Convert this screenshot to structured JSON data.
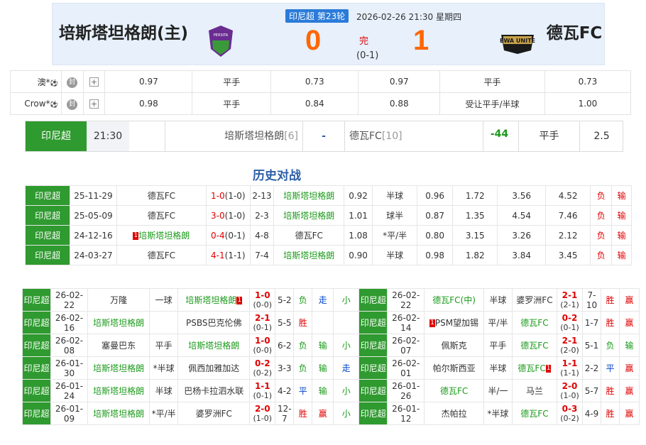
{
  "match": {
    "league_round": "印尼超 第23轮",
    "datetime": "2026-02-26 21:30 星期四",
    "home": "培斯塔坦格朗(主)",
    "away": "德瓦FC",
    "home_score": "0",
    "away_score": "1",
    "status": "完",
    "halftime": "(0-1)",
    "home_logo_text": "PERSITA",
    "away_logo_text": "DEWA UNITED"
  },
  "odds": [
    {
      "company": "澳*",
      "icon": "封",
      "v1": "0.97",
      "h1": "平手",
      "v2": "0.73",
      "v3": "0.97",
      "h2": "平手",
      "v4": "0.73"
    },
    {
      "company": "Crow*",
      "icon": "封",
      "v1": "0.98",
      "h1": "平手",
      "v2": "0.84",
      "v3": "0.88",
      "h2": "受让平手/半球",
      "v4": "1.00"
    }
  ],
  "bar": {
    "league": "印尼超",
    "time": "21:30",
    "home": "培斯塔坦格朗",
    "home_rank": "[6]",
    "sep": "-",
    "away": "德瓦FC",
    "away_rank": "[10]",
    "diff": "-44",
    "hcp": "平手",
    "val": "2.5"
  },
  "history_title": "历史对战",
  "h2h": [
    {
      "lg": "印尼超",
      "date": "25-11-29",
      "home": "德瓦FC",
      "score": "1-0",
      "ht": "(1-0)",
      "corner": "2-13",
      "away": "培斯塔坦格朗",
      "o1": "0.92",
      "hcp": "半球",
      "o2": "0.96",
      "e1": "1.72",
      "e2": "3.56",
      "e3": "4.52",
      "res": "负",
      "ou": "输"
    },
    {
      "lg": "印尼超",
      "date": "25-05-09",
      "home": "德瓦FC",
      "score": "3-0",
      "ht": "(1-0)",
      "corner": "2-3",
      "away": "培斯塔坦格朗",
      "o1": "1.01",
      "hcp": "球半",
      "o2": "0.87",
      "e1": "1.35",
      "e2": "4.54",
      "e3": "7.46",
      "res": "负",
      "ou": "输"
    },
    {
      "lg": "印尼超",
      "date": "24-12-16",
      "home": "培斯塔坦格朗",
      "home_card": "1",
      "score": "0-4",
      "ht": "(0-1)",
      "corner": "4-8",
      "away": "德瓦FC",
      "o1": "1.08",
      "hcp": "*平/半",
      "o2": "0.80",
      "e1": "3.15",
      "e2": "3.26",
      "e3": "2.12",
      "res": "负",
      "ou": "输"
    },
    {
      "lg": "印尼超",
      "date": "24-03-27",
      "home": "德瓦FC",
      "score": "4-1",
      "ht": "(1-1)",
      "corner": "7-4",
      "away": "培斯塔坦格朗",
      "o1": "0.90",
      "hcp": "半球",
      "o2": "0.98",
      "e1": "1.82",
      "e2": "3.84",
      "e3": "3.45",
      "res": "负",
      "ou": "输"
    }
  ],
  "recent_home": [
    {
      "lg": "印尼超",
      "date": "26-02-22",
      "home": "万隆",
      "hcp": "一球",
      "away": "培斯塔坦格朗",
      "away_card": "1",
      "score": "1-0",
      "ht": "(0-0)",
      "corner": "5-2",
      "res": "负",
      "pan": "走",
      "ou": "小"
    },
    {
      "lg": "印尼超",
      "date": "26-02-16",
      "home": "培斯塔坦格朗",
      "hcp": "",
      "away": "PSBS巴克伦佛",
      "score": "2-1",
      "ht": "(0-1)",
      "corner": "5-5",
      "res": "胜",
      "pan": "",
      "ou": ""
    },
    {
      "lg": "印尼超",
      "date": "26-02-08",
      "home": "塞曼巴东",
      "hcp": "平手",
      "away": "培斯塔坦格朗",
      "score": "1-0",
      "ht": "(0-0)",
      "corner": "6-2",
      "res": "负",
      "pan": "输",
      "ou": "小"
    },
    {
      "lg": "印尼超",
      "date": "26-01-30",
      "home": "培斯塔坦格朗",
      "hcp": "*半球",
      "away": "佩西加雅加达",
      "score": "0-2",
      "ht": "(0-2)",
      "corner": "3-3",
      "res": "负",
      "pan": "输",
      "ou": "走"
    },
    {
      "lg": "印尼超",
      "date": "26-01-24",
      "home": "培斯塔坦格朗",
      "hcp": "半球",
      "away": "巴杨卡拉泗水联",
      "score": "1-1",
      "ht": "(0-1)",
      "corner": "4-2",
      "res": "平",
      "pan": "输",
      "ou": "小"
    },
    {
      "lg": "印尼超",
      "date": "26-01-09",
      "home": "培斯塔坦格朗",
      "hcp": "*平/半",
      "away": "婆罗洲FC",
      "score": "2-0",
      "ht": "(1-0)",
      "corner": "12-7",
      "res": "胜",
      "pan": "赢",
      "ou": "小"
    }
  ],
  "recent_away": [
    {
      "lg": "印尼超",
      "date": "26-02-22",
      "home": "德瓦FC(中)",
      "hcp": "半球",
      "away": "婆罗洲FC",
      "score": "2-1",
      "ht": "(2-1)",
      "corner": "7-10",
      "res": "胜",
      "pan": "赢"
    },
    {
      "lg": "印尼超",
      "date": "26-02-14",
      "home": "PSM望加锡",
      "home_card": "1",
      "hcp": "平/半",
      "away": "德瓦FC",
      "score": "0-2",
      "ht": "(0-1)",
      "corner": "1-7",
      "res": "胜",
      "pan": "赢"
    },
    {
      "lg": "印尼超",
      "date": "26-02-07",
      "home": "佩斯克",
      "hcp": "平手",
      "away": "德瓦FC",
      "score": "2-1",
      "ht": "(2-0)",
      "corner": "5-1",
      "res": "负",
      "pan": "输"
    },
    {
      "lg": "印尼超",
      "date": "26-02-01",
      "home": "帕尔斯西亚",
      "hcp": "半球",
      "away": "德瓦FC",
      "away_card": "1",
      "score": "1-1",
      "ht": "(1-1)",
      "corner": "2-2",
      "res": "平",
      "pan": "赢"
    },
    {
      "lg": "印尼超",
      "date": "26-01-26",
      "home": "德瓦FC",
      "hcp": "半/一",
      "away": "马兰",
      "score": "2-0",
      "ht": "(1-0)",
      "corner": "5-7",
      "res": "胜",
      "pan": "赢"
    },
    {
      "lg": "印尼超",
      "date": "26-01-12",
      "home": "杰帕拉",
      "hcp": "*半球",
      "away": "德瓦FC",
      "score": "0-3",
      "ht": "(0-2)",
      "corner": "4-9",
      "res": "胜",
      "pan": "赢"
    }
  ],
  "colors": {
    "green": "#2f9a2f",
    "red": "#e00000",
    "orange": "#ff6600",
    "blue": "#2b7bd9"
  }
}
